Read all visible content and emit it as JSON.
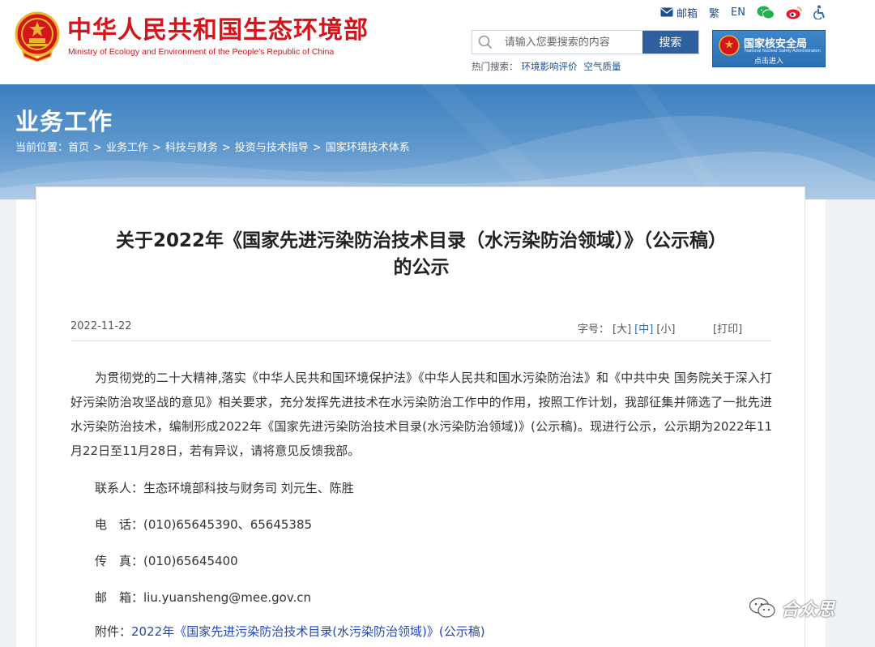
{
  "header": {
    "site_title": "中华人民共和国生态环境部",
    "site_subtitle": "Ministry of Ecology and Environment of the People's Republic of China",
    "toplinks": {
      "mail": "邮箱",
      "traditional": "繁",
      "english": "EN"
    },
    "search": {
      "placeholder": "请输入您要搜索的内容",
      "button": "搜索"
    },
    "hot_search": {
      "label": "热门搜索：",
      "items": [
        "环境影响评价",
        "空气质量"
      ]
    },
    "nnsa": {
      "title": "国家核安全局",
      "subtitle": "National Nuclear Safety Administration",
      "enter": "点击进入"
    },
    "colors": {
      "brand_red": "#d3151c",
      "nav_blue": "#2f5f9c"
    }
  },
  "banner": {
    "section_title": "业务工作",
    "breadcrumb_label": "当前位置：",
    "breadcrumb": [
      "首页",
      "业务工作",
      "科技与财务",
      "投资与技术指导",
      "国家环境技术体系"
    ]
  },
  "article": {
    "title_line1": "关于2022年《国家先进污染防治技术目录（水污染防治领域）》（公示稿）",
    "title_line2": "的公示",
    "date": "2022-11-22",
    "font_size_label": "字号：",
    "font_sizes": [
      "[大]",
      "[中]",
      "[小]"
    ],
    "print": "[打印]",
    "paragraph": "为贯彻党的二十大精神,落实《中华人民共和国环境保护法》《中华人民共和国水污染防治法》和《中共中央 国务院关于深入打好污染防治攻坚战的意见》相关要求，充分发挥先进技术在水污染防治工作中的作用，按照工作计划，我部征集并筛选了一批先进水污染防治技术，编制形成2022年《国家先进污染防治技术目录(水污染防治领域)》(公示稿)。现进行公示，公示期为2022年11月22日至11月28日，若有异议，请将意见反馈我部。",
    "contacts": [
      {
        "label": "联系人：",
        "value": "生态环境部科技与财务司 刘元生、陈胜"
      },
      {
        "label": "电　话：",
        "value": "(010)65645390、65645385"
      },
      {
        "label": "传　真：",
        "value": "(010)65645400"
      },
      {
        "label": "邮　箱：",
        "value": "liu.yuansheng@mee.gov.cn"
      }
    ],
    "attachment_label": "附件：",
    "attachment_link": "2022年《国家先进污染防治技术目录(水污染防治领域)》(公示稿)"
  },
  "watermark": {
    "text": "合众思"
  }
}
